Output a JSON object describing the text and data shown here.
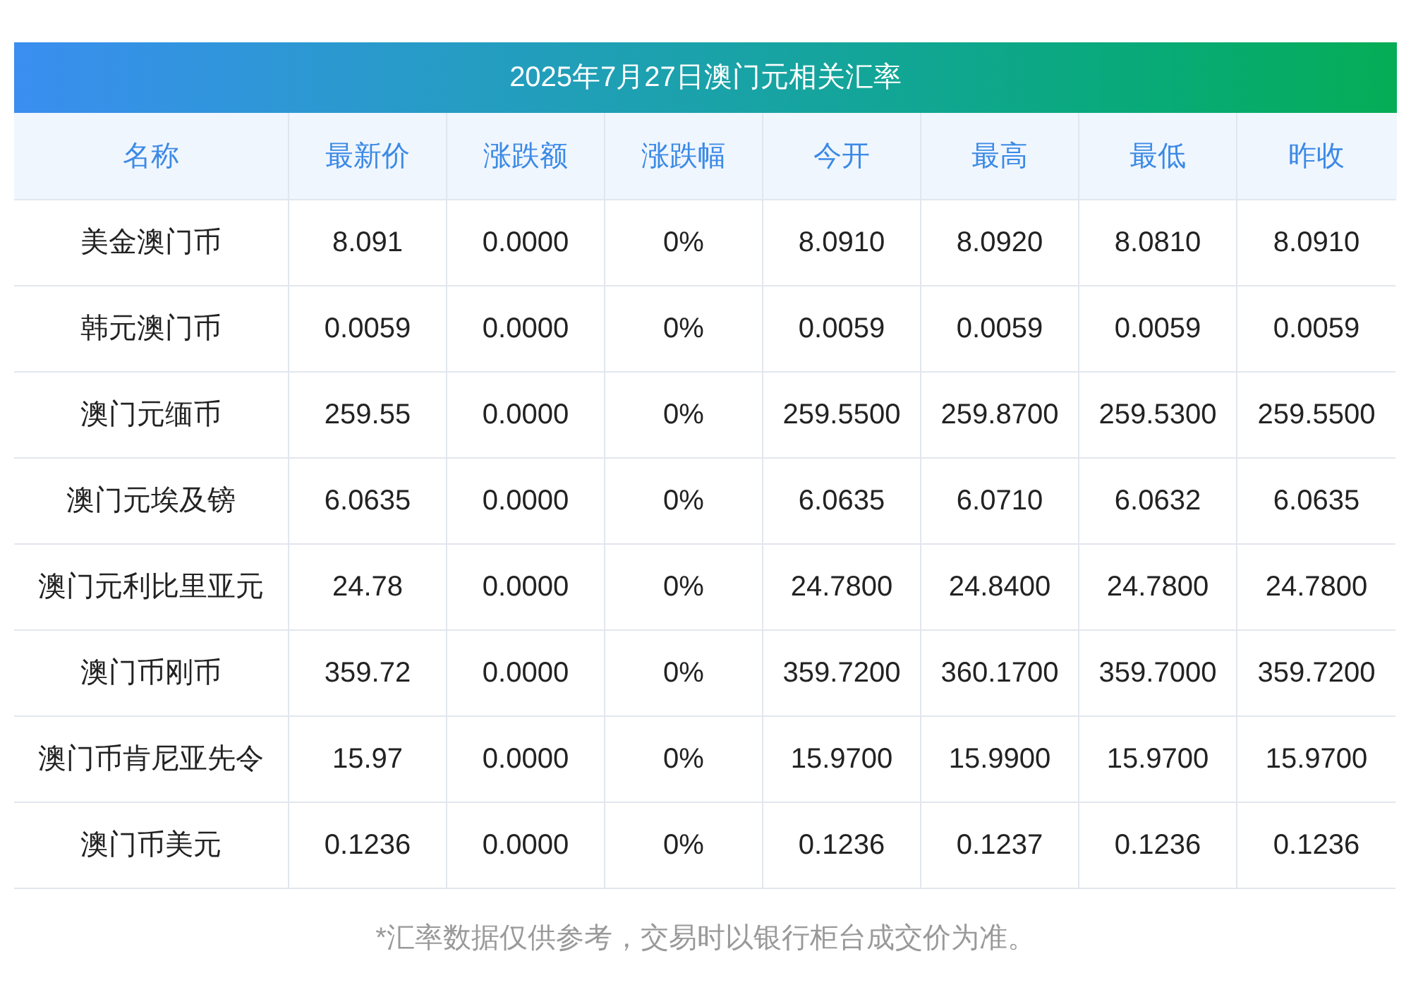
{
  "title": "2025年7月27日澳门元相关汇率",
  "columns": [
    "名称",
    "最新价",
    "涨跌额",
    "涨跌幅",
    "今开",
    "最高",
    "最低",
    "昨收"
  ],
  "rows": [
    [
      "美金澳门币",
      "8.091",
      "0.0000",
      "0%",
      "8.0910",
      "8.0920",
      "8.0810",
      "8.0910"
    ],
    [
      "韩元澳门币",
      "0.0059",
      "0.0000",
      "0%",
      "0.0059",
      "0.0059",
      "0.0059",
      "0.0059"
    ],
    [
      "澳门元缅币",
      "259.55",
      "0.0000",
      "0%",
      "259.5500",
      "259.8700",
      "259.5300",
      "259.5500"
    ],
    [
      "澳门元埃及镑",
      "6.0635",
      "0.0000",
      "0%",
      "6.0635",
      "6.0710",
      "6.0632",
      "6.0635"
    ],
    [
      "澳门元利比里亚元",
      "24.78",
      "0.0000",
      "0%",
      "24.7800",
      "24.8400",
      "24.7800",
      "24.7800"
    ],
    [
      "澳门币刚币",
      "359.72",
      "0.0000",
      "0%",
      "359.7200",
      "360.1700",
      "359.7000",
      "359.7200"
    ],
    [
      "澳门币肯尼亚先令",
      "15.97",
      "0.0000",
      "0%",
      "15.9700",
      "15.9900",
      "15.9700",
      "15.9700"
    ],
    [
      "澳门币美元",
      "0.1236",
      "0.0000",
      "0%",
      "0.1236",
      "0.1237",
      "0.1236",
      "0.1236"
    ]
  ],
  "note": "*汇率数据仅供参考，交易时以银行柜台成交价为准。"
}
